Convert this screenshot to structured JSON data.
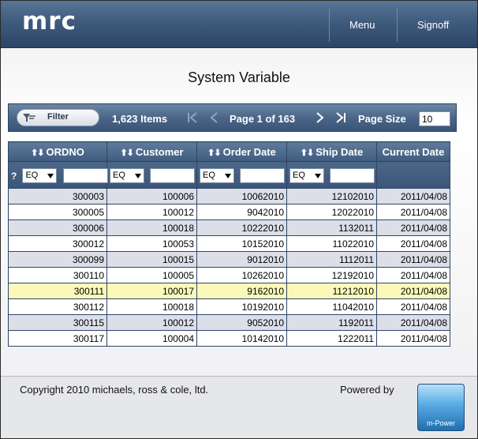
{
  "header": {
    "logo": "mrc",
    "menu_label": "Menu",
    "signoff_label": "Signoff"
  },
  "page_title": "System Variable",
  "toolbar": {
    "filter_label": "Filter",
    "items_count": "1,623 Items",
    "page_info": "Page 1 of 163",
    "page_size_label": "Page Size",
    "page_size_value": "10"
  },
  "table": {
    "columns": [
      "ORDNO",
      "Customer",
      "Order Date",
      "Ship Date",
      "Current Date"
    ],
    "filter": {
      "question": "?",
      "operator": "EQ"
    },
    "rows": [
      [
        "300003",
        "100006",
        "10062010",
        "12102010",
        "2011/04/08"
      ],
      [
        "300005",
        "100012",
        "9042010",
        "12022010",
        "2011/04/08"
      ],
      [
        "300006",
        "100018",
        "10222010",
        "1132011",
        "2011/04/08"
      ],
      [
        "300012",
        "100053",
        "10152010",
        "11022010",
        "2011/04/08"
      ],
      [
        "300099",
        "100015",
        "9012010",
        "1112011",
        "2011/04/08"
      ],
      [
        "300110",
        "100005",
        "10262010",
        "12192010",
        "2011/04/08"
      ],
      [
        "300111",
        "100017",
        "9162010",
        "11212010",
        "2011/04/08"
      ],
      [
        "300112",
        "100018",
        "10192010",
        "11042010",
        "2011/04/08"
      ],
      [
        "300115",
        "100012",
        "9052010",
        "1192011",
        "2011/04/08"
      ],
      [
        "300117",
        "100004",
        "10142010",
        "1222011",
        "2011/04/08"
      ]
    ],
    "highlight_color": "#fbf9b9"
  },
  "footer": {
    "copyright": "Copyright 2010 michaels, ross & cole, ltd.",
    "powered_by": "Powered by",
    "logo_text": "m-Power"
  }
}
